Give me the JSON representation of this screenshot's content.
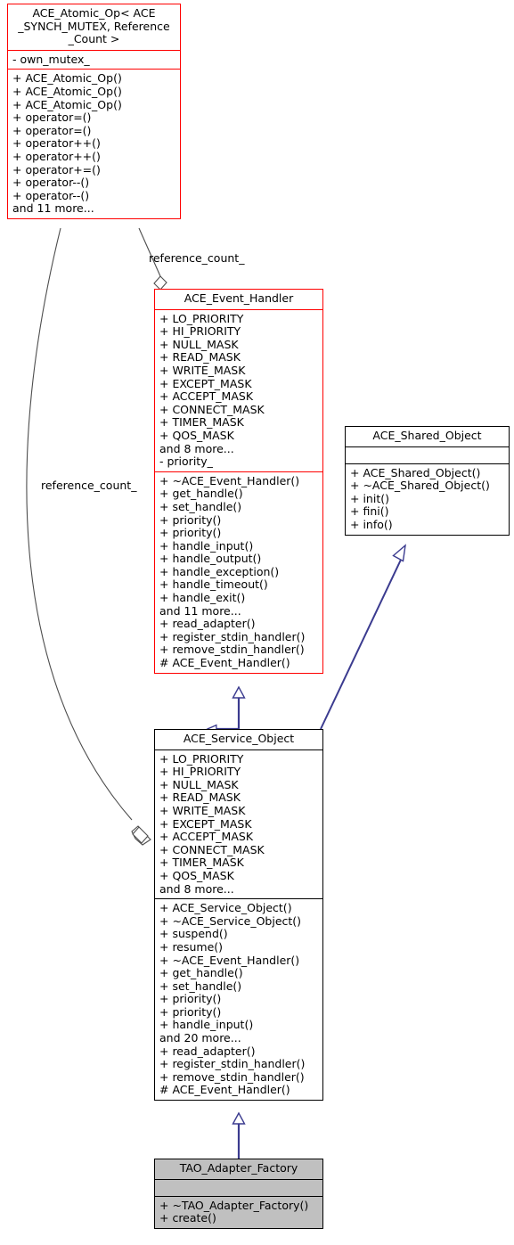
{
  "diagram": {
    "type": "uml-class-diagram",
    "background": "#ffffff",
    "colors": {
      "highlight_border": "#ff0000",
      "normal_border": "#000000",
      "inheritance_arrow": "#3b3b8f",
      "aggregation_line": "#4d4d4d",
      "leaf_fill": "#c0c0c0"
    }
  },
  "classes": {
    "ace_atomic_op": {
      "name": "ACE_Atomic_Op< ACE\n_SYNCH_MUTEX, Reference\n_Count >",
      "attributes": [
        "- own_mutex_"
      ],
      "operations": [
        "+ ACE_Atomic_Op()",
        "+ ACE_Atomic_Op()",
        "+ ACE_Atomic_Op()",
        "+ operator=()",
        "+ operator=()",
        "+ operator++()",
        "+ operator++()",
        "+ operator+=()",
        "+ operator--()",
        "+ operator--()",
        "and 11 more..."
      ]
    },
    "ace_event_handler": {
      "name": "ACE_Event_Handler",
      "attributes": [
        "+ LO_PRIORITY",
        "+ HI_PRIORITY",
        "+ NULL_MASK",
        "+ READ_MASK",
        "+ WRITE_MASK",
        "+ EXCEPT_MASK",
        "+ ACCEPT_MASK",
        "+ CONNECT_MASK",
        "+ TIMER_MASK",
        "+ QOS_MASK",
        "and 8 more...",
        "- priority_"
      ],
      "operations": [
        "+ ~ACE_Event_Handler()",
        "+ get_handle()",
        "+ set_handle()",
        "+ priority()",
        "+ priority()",
        "+ handle_input()",
        "+ handle_output()",
        "+ handle_exception()",
        "+ handle_timeout()",
        "+ handle_exit()",
        "and 11 more...",
        "+ read_adapter()",
        "+ register_stdin_handler()",
        "+ remove_stdin_handler()",
        "# ACE_Event_Handler()"
      ]
    },
    "ace_shared_object": {
      "name": "ACE_Shared_Object",
      "attributes": [],
      "operations": [
        "+ ACE_Shared_Object()",
        "+ ~ACE_Shared_Object()",
        "+ init()",
        "+ fini()",
        "+ info()"
      ]
    },
    "ace_service_object": {
      "name": "ACE_Service_Object",
      "attributes": [
        "+ LO_PRIORITY",
        "+ HI_PRIORITY",
        "+ NULL_MASK",
        "+ READ_MASK",
        "+ WRITE_MASK",
        "+ EXCEPT_MASK",
        "+ ACCEPT_MASK",
        "+ CONNECT_MASK",
        "+ TIMER_MASK",
        "+ QOS_MASK",
        "and 8 more..."
      ],
      "operations": [
        "+ ACE_Service_Object()",
        "+ ~ACE_Service_Object()",
        "+ suspend()",
        "+ resume()",
        "+ ~ACE_Event_Handler()",
        "+ get_handle()",
        "+ set_handle()",
        "+ priority()",
        "+ priority()",
        "+ handle_input()",
        "and 20 more...",
        "+ read_adapter()",
        "+ register_stdin_handler()",
        "+ remove_stdin_handler()",
        "# ACE_Event_Handler()"
      ]
    },
    "tao_adapter_factory": {
      "name": "TAO_Adapter_Factory",
      "attributes": [],
      "operations": [
        "+ ~TAO_Adapter_Factory()",
        "+ create()"
      ]
    }
  },
  "edges": {
    "aggregation_to_event_handler": {
      "label": "reference_count_",
      "from": "ace_atomic_op",
      "to": "ace_event_handler",
      "kind": "aggregation"
    },
    "aggregation_to_service_object": {
      "label": "reference_count_",
      "from": "ace_atomic_op",
      "to": "ace_service_object",
      "kind": "aggregation"
    },
    "inheritance_event_handler": {
      "from": "ace_service_object",
      "to": "ace_event_handler",
      "kind": "generalization"
    },
    "inheritance_shared_object": {
      "from": "ace_service_object",
      "to": "ace_shared_object",
      "kind": "generalization"
    },
    "inheritance_adapter_factory": {
      "from": "tao_adapter_factory",
      "to": "ace_service_object",
      "kind": "generalization"
    }
  }
}
